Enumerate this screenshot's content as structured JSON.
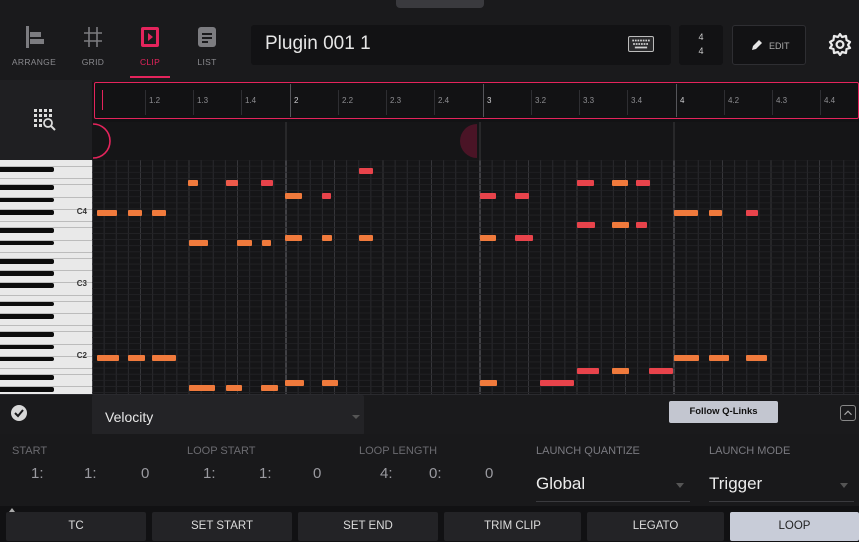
{
  "modes": [
    {
      "label": "ARRANGE",
      "icon": "arrange-icon"
    },
    {
      "label": "GRID",
      "icon": "grid-icon"
    },
    {
      "label": "CLIP",
      "icon": "clip-icon",
      "active": true
    },
    {
      "label": "LIST",
      "icon": "list-icon"
    }
  ],
  "header": {
    "title": "Plugin 001 1",
    "keyboard_icon": "keyboard-icon",
    "time_sig_num": "4",
    "time_sig_den": "4",
    "edit_label": "EDIT",
    "settings_icon": "gear-icon"
  },
  "ruler": {
    "ticks": [
      "1.2",
      "1.3",
      "1.4",
      "2",
      "2.2",
      "2.3",
      "2.4",
      "3",
      "3.2",
      "3.3",
      "3.4",
      "4",
      "4.2",
      "4.3",
      "4.4"
    ]
  },
  "piano": {
    "octave_labels": [
      "C4",
      "C3",
      "C2"
    ]
  },
  "velocity_bar": {
    "lane": "Velocity",
    "follow_qlinks": "Follow Q-Links"
  },
  "params": {
    "start_label": "START",
    "start_values": [
      "1:",
      "1:",
      "0"
    ],
    "loop_start_label": "LOOP START",
    "loop_start_values": [
      "1:",
      "1:",
      "0"
    ],
    "loop_length_label": "LOOP LENGTH",
    "loop_length_values": [
      "4:",
      "0:",
      "0"
    ],
    "launch_quantize_label": "LAUNCH QUANTIZE",
    "launch_quantize_value": "Global",
    "launch_mode_label": "LAUNCH MODE",
    "launch_mode_value": "Trigger"
  },
  "buttons": [
    "TC",
    "SET START",
    "SET END",
    "TRIM CLIP",
    "LEGATO",
    "LOOP"
  ],
  "active_button": "LOOP",
  "colors": {
    "accent": "#e4245c",
    "note_red": "#e8434b",
    "note_orange": "#f07a3c",
    "note_salmon": "#ee5a4a"
  }
}
